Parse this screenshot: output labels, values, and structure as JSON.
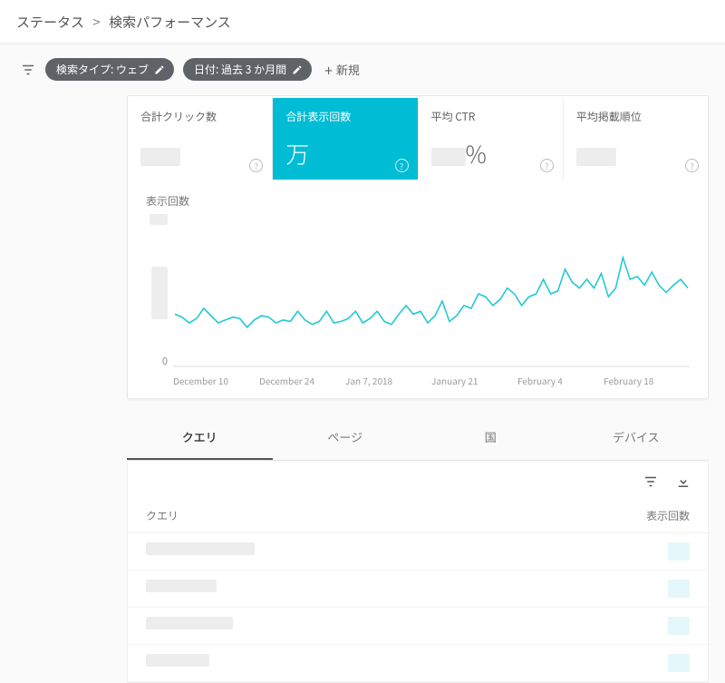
{
  "breadcrumb": {
    "parent": "ステータス",
    "separator": ">",
    "current": "検索パフォーマンス"
  },
  "filters": {
    "type_chip": "検索タイプ: ウェブ",
    "date_chip": "日付: 過去 3 か月間",
    "new_label": "新規"
  },
  "metrics": {
    "clicks": {
      "label": "合計クリック数"
    },
    "impressions": {
      "label": "合計表示回数",
      "unit": "万"
    },
    "ctr": {
      "label": "平均 CTR",
      "unit": "%"
    },
    "position": {
      "label": "平均掲載順位"
    }
  },
  "chart_data": {
    "type": "line",
    "title": "表示回数",
    "xlabel": "",
    "ylabel": "表示回数",
    "ylim": [
      0,
      100
    ],
    "categories": [
      "December 10",
      "December 24",
      "Jan 7, 2018",
      "January 21",
      "February 4",
      "February 18"
    ],
    "series": [
      {
        "name": "表示回数",
        "values": [
          36,
          34,
          30,
          33,
          40,
          35,
          30,
          32,
          34,
          33,
          27,
          32,
          35,
          34,
          30,
          32,
          31,
          38,
          32,
          29,
          31,
          38,
          30,
          31,
          33,
          38,
          30,
          33,
          38,
          31,
          29,
          36,
          42,
          36,
          38,
          30,
          35,
          45,
          31,
          35,
          42,
          40,
          50,
          48,
          42,
          46,
          54,
          50,
          42,
          48,
          50,
          60,
          50,
          52,
          67,
          58,
          54,
          60,
          54,
          64,
          48,
          54,
          75,
          60,
          62,
          56,
          65,
          56,
          51,
          56,
          60,
          54
        ]
      }
    ],
    "x_ticks": [
      "December 10",
      "December 24",
      "Jan 7, 2018",
      "January 21",
      "February 4",
      "February 18"
    ]
  },
  "tabs": {
    "query": "クエリ",
    "page": "ページ",
    "country": "国",
    "device": "デバイス"
  },
  "table": {
    "head_query": "クエリ",
    "head_impressions": "表示回数",
    "rows": [
      {
        "qw": 120
      },
      {
        "qw": 78
      },
      {
        "qw": 96
      },
      {
        "qw": 70
      }
    ]
  },
  "zero_label": "0"
}
